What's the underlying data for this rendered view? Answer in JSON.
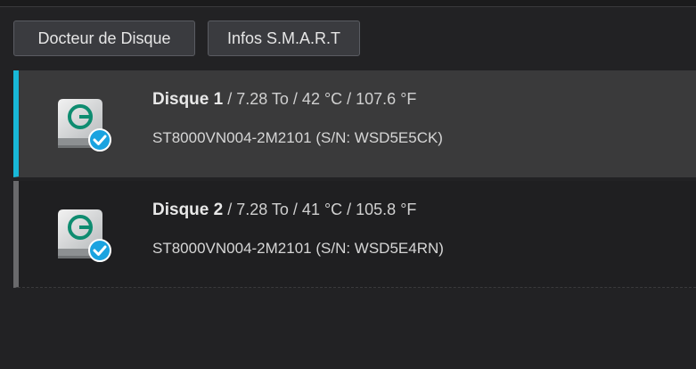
{
  "toolbar": {
    "disk_doctor_label": "Docteur de Disque",
    "smart_info_label": "Infos S.M.A.R.T"
  },
  "colors": {
    "accent": "#18b8d8",
    "status_ok": "#1aa3e0"
  },
  "disks": [
    {
      "name": "Disque 1",
      "details": " / 7.28 To / 42 °C / 107.6 °F",
      "model": "ST8000VN004-2M2101 (S/N: WSD5E5CK)",
      "selected": true,
      "icon": "hard-drive-icon",
      "status_icon": "check-circle-icon"
    },
    {
      "name": "Disque 2",
      "details": " / 7.28 To / 41 °C / 105.8 °F",
      "model": "ST8000VN004-2M2101 (S/N: WSD5E4RN)",
      "selected": false,
      "icon": "hard-drive-icon",
      "status_icon": "check-circle-icon"
    }
  ]
}
